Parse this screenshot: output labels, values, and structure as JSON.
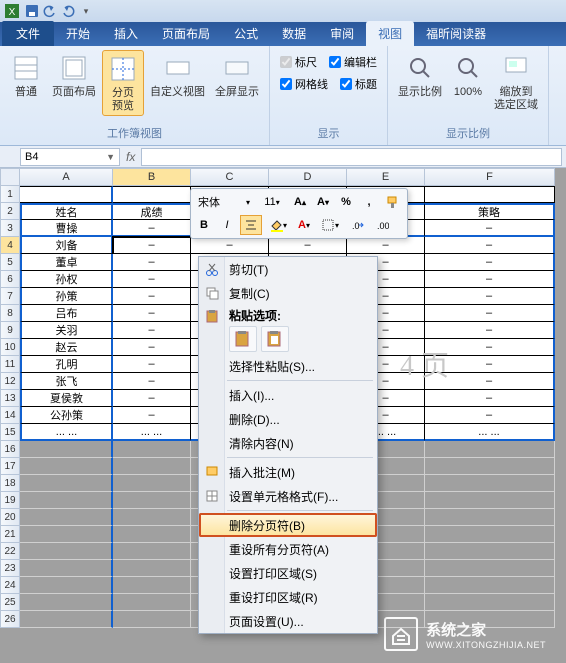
{
  "qat": {
    "save": "保存",
    "undo": "撤销",
    "redo": "重做"
  },
  "tabs": {
    "file": "文件",
    "items": [
      "开始",
      "插入",
      "页面布局",
      "公式",
      "数据",
      "审阅",
      "视图",
      "福昕阅读器"
    ],
    "active_index": 6
  },
  "ribbon": {
    "group1": {
      "label": "工作簿视图",
      "buttons": {
        "normal": "普通",
        "page_layout": "页面布局",
        "page_break": "分页\n预览",
        "custom": "自定义视图",
        "fullscreen": "全屏显示"
      },
      "active": "page_break"
    },
    "group2": {
      "label": "显示",
      "ruler": "标尺",
      "formula_bar": "编辑栏",
      "gridlines": "网格线",
      "headings": "标题",
      "ruler_checked": true,
      "formula_bar_checked": true,
      "gridlines_checked": true,
      "headings_checked": true
    },
    "group3": {
      "label": "显示比例",
      "zoom": "显示比例",
      "hundred": "100%",
      "fit": "缩放到\n选定区域"
    }
  },
  "name_box": "B4",
  "columns": [
    "A",
    "B",
    "C",
    "D",
    "E",
    "F"
  ],
  "row_headers": [
    1,
    2,
    3,
    4,
    5,
    6,
    7,
    8,
    9,
    10,
    11,
    12,
    13,
    14,
    15,
    16,
    17,
    18,
    19,
    20,
    21,
    22,
    23,
    24,
    25,
    26
  ],
  "table": {
    "header": {
      "A": "姓名",
      "B": "成绩",
      "C": "",
      "D": "",
      "E": "",
      "F": "策略"
    },
    "rows": [
      {
        "A": "曹操",
        "B": "–",
        "C": "–",
        "D": "–",
        "E": "–",
        "F": "–"
      },
      {
        "A": "刘备",
        "B": "–",
        "C": "–",
        "D": "–",
        "E": "–",
        "F": "–"
      },
      {
        "A": "董卓",
        "B": "–",
        "C": "–",
        "D": "–",
        "E": "–",
        "F": "–"
      },
      {
        "A": "孙权",
        "B": "–",
        "C": "–",
        "D": "–",
        "E": "–",
        "F": "–"
      },
      {
        "A": "孙策",
        "B": "–",
        "C": "–",
        "D": "–",
        "E": "–",
        "F": "–"
      },
      {
        "A": "吕布",
        "B": "–",
        "C": "–",
        "D": "–",
        "E": "–",
        "F": "–"
      },
      {
        "A": "关羽",
        "B": "–",
        "C": "–",
        "D": "–",
        "E": "–",
        "F": "–"
      },
      {
        "A": "赵云",
        "B": "–",
        "C": "–",
        "D": "–",
        "E": "–",
        "F": "–"
      },
      {
        "A": "孔明",
        "B": "–",
        "C": "–",
        "D": "–",
        "E": "–",
        "F": "–"
      },
      {
        "A": "张飞",
        "B": "–",
        "C": "–",
        "D": "–",
        "E": "–",
        "F": "–"
      },
      {
        "A": "夏侯敦",
        "B": "–",
        "C": "–",
        "D": "–",
        "E": "–",
        "F": "–"
      },
      {
        "A": "公孙策",
        "B": "–",
        "C": "–",
        "D": "–",
        "E": "–",
        "F": "–"
      },
      {
        "A": "... ...",
        "B": "... ...",
        "C": "... ...",
        "D": "... ...",
        "E": "... ...",
        "F": "... ..."
      }
    ]
  },
  "active_cell": "B4",
  "mini_toolbar": {
    "font": "宋体",
    "size": "11",
    "grow": "A",
    "shrink": "A"
  },
  "context_menu": {
    "cut": "剪切(T)",
    "copy": "复制(C)",
    "paste_options": "粘贴选项:",
    "paste_special": "选择性粘贴(S)...",
    "insert": "插入(I)...",
    "delete": "删除(D)...",
    "clear": "清除内容(N)",
    "insert_comment": "插入批注(M)",
    "format_cells": "设置单元格格式(F)...",
    "remove_page_break": "删除分页符(B)",
    "reset_all_breaks": "重设所有分页符(A)",
    "set_print_area": "设置打印区域(S)",
    "reset_print_area": "重设打印区域(R)",
    "page_setup": "页面设置(U)..."
  },
  "watermark": {
    "title": "系统之家",
    "url": "WWW.XITONGZHIJIA.NET"
  },
  "page_label": "4 页"
}
